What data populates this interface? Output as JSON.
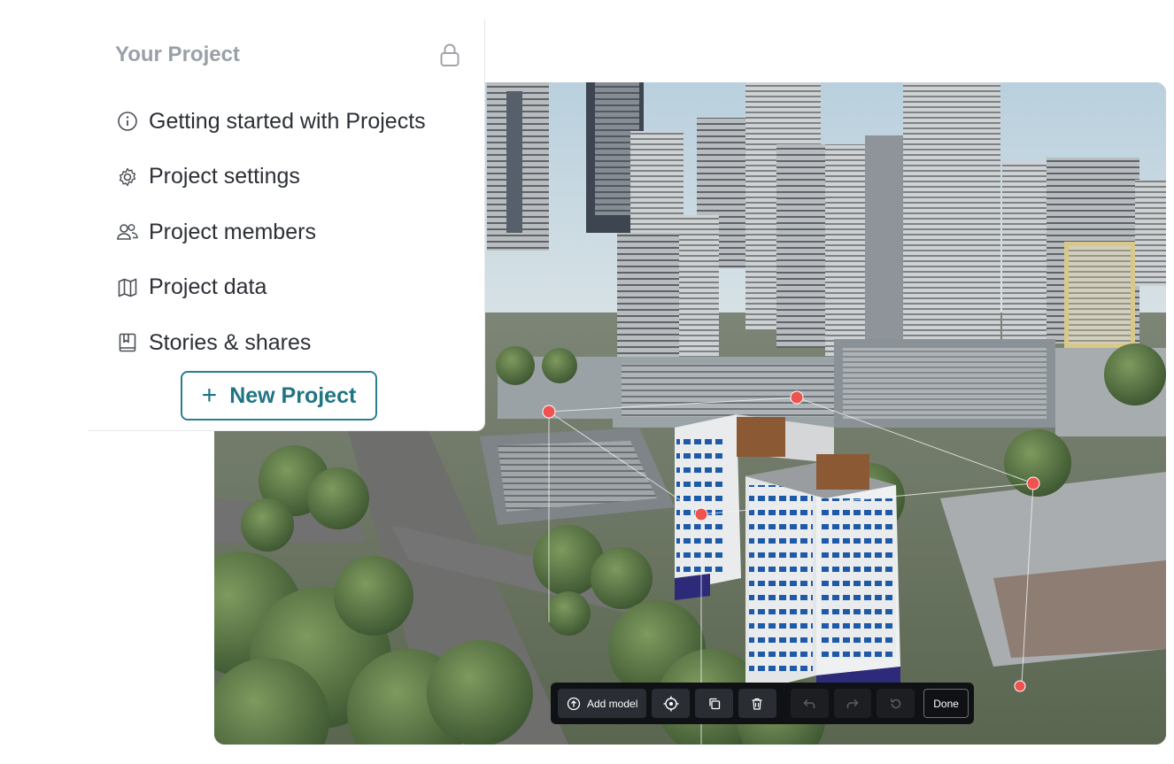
{
  "panel": {
    "title": "Your Project",
    "menu": [
      {
        "label": "Getting started with Projects",
        "icon": "info-icon"
      },
      {
        "label": "Project settings",
        "icon": "gear-icon"
      },
      {
        "label": "Project members",
        "icon": "users-icon"
      },
      {
        "label": "Project data",
        "icon": "map-icon"
      },
      {
        "label": "Stories & shares",
        "icon": "book-icon"
      }
    ],
    "new_project_label": "New Project"
  },
  "toolbar": {
    "add_model_label": "Add model",
    "done_label": "Done",
    "icons": [
      "upload-icon",
      "target-icon",
      "duplicate-icon",
      "trash-icon",
      "undo-icon",
      "redo-icon",
      "reset-icon"
    ]
  },
  "colors": {
    "accent": "#1f7584",
    "panel_title": "#9aa0a7",
    "toolbar_bg": "#0f1114",
    "handle": "#ef5350"
  }
}
